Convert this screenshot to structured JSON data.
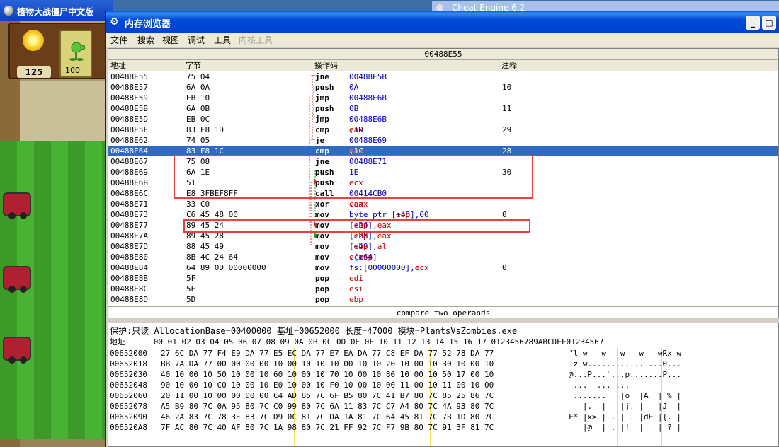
{
  "game": {
    "title": "植物大战僵尸中文版",
    "sun_count": "125",
    "seed_cost": "100",
    "colors": {
      "lawn_light": "#48b232",
      "lawn_dark": "#3c9a28"
    }
  },
  "background_window": {
    "title": "Cheat Engine 6.2"
  },
  "memory_viewer": {
    "title": "内存浏览器",
    "window_buttons": {
      "minimize": "_",
      "maximize": "□"
    },
    "menu": [
      "文件",
      "搜索",
      "视图",
      "调试",
      "工具",
      "内核工具"
    ],
    "disasm": {
      "current_address": "00488E55",
      "columns": [
        "地址",
        "字节",
        "操作码",
        "注释"
      ],
      "rows": [
        {
          "addr": "00488E55",
          "bytes": "75 04",
          "mnem": "jne",
          "ops": "00488E5B",
          "comment": ""
        },
        {
          "addr": "00488E57",
          "bytes": "6A 0A",
          "mnem": "push",
          "ops": "0A",
          "comment": "10"
        },
        {
          "addr": "00488E59",
          "bytes": "EB 10",
          "mnem": "jmp",
          "ops": "00488E6B",
          "comment": ""
        },
        {
          "addr": "00488E5B",
          "bytes": "6A 0B",
          "mnem": "push",
          "ops": "0B",
          "comment": "11"
        },
        {
          "addr": "00488E5D",
          "bytes": "EB 0C",
          "mnem": "jmp",
          "ops": "00488E6B",
          "comment": ""
        },
        {
          "addr": "00488E5F",
          "bytes": "83 F8 1D",
          "mnem": "cmp",
          "ops": "eax,1D",
          "comment": "29"
        },
        {
          "addr": "00488E62",
          "bytes": "74 05",
          "mnem": "je",
          "ops": "00488E69",
          "comment": ""
        },
        {
          "addr": "00488E64",
          "bytes": "83 F8 1C",
          "mnem": "cmp",
          "ops": "eax,1C",
          "comment": "28",
          "selected": true
        },
        {
          "addr": "00488E67",
          "bytes": "75 08",
          "mnem": "jne",
          "ops": "00488E71",
          "comment": ""
        },
        {
          "addr": "00488E69",
          "bytes": "6A 1E",
          "mnem": "push",
          "ops": "1E",
          "comment": "30"
        },
        {
          "addr": "00488E6B",
          "bytes": "51",
          "mnem": "push",
          "ops": "ecx",
          "comment": ""
        },
        {
          "addr": "00488E6C",
          "bytes": "E8 3FBEF8FF",
          "mnem": "call",
          "ops": "00414CB0",
          "comment": ""
        },
        {
          "addr": "00488E71",
          "bytes": "33 C0",
          "mnem": "xor",
          "ops": "eax,eax",
          "comment": ""
        },
        {
          "addr": "00488E73",
          "bytes": "C6 45 48 00",
          "mnem": "mov",
          "ops": "byte ptr [ebp+48],00",
          "comment": "0"
        },
        {
          "addr": "00488E77",
          "bytes": "89 45 24",
          "mnem": "mov",
          "ops": "[ebp+24],eax",
          "comment": ""
        },
        {
          "addr": "00488E7A",
          "bytes": "89 45 28",
          "mnem": "mov",
          "ops": "[ebp+28],eax",
          "comment": ""
        },
        {
          "addr": "00488E7D",
          "bytes": "88 45 49",
          "mnem": "mov",
          "ops": "[ebp+49],al",
          "comment": ""
        },
        {
          "addr": "00488E80",
          "bytes": "8B 4C 24 64",
          "mnem": "mov",
          "ops": "ecx,[esp+64]",
          "comment": ""
        },
        {
          "addr": "00488E84",
          "bytes": "64 89 0D 00000000",
          "mnem": "mov",
          "ops": "fs:[00000000],ecx",
          "comment": "0"
        },
        {
          "addr": "00488E8B",
          "bytes": "5F",
          "mnem": "pop",
          "ops": "edi",
          "comment": ""
        },
        {
          "addr": "00488E8C",
          "bytes": "5E",
          "mnem": "pop",
          "ops": "esi",
          "comment": ""
        },
        {
          "addr": "00488E8D",
          "bytes": "5D",
          "mnem": "pop",
          "ops": "ebp",
          "comment": ""
        }
      ],
      "description": "compare two operands"
    },
    "hex": {
      "info": "保护:只读  AllocationBase=00400000 基址=00652000 长度=47000 模块=PlantsVsZombies.exe",
      "header": "地址      00 01 02 03 04 05 06 07 08 09 0A 0B 0C 0D 0E 0F 10 11 12 13 14 15 16 17 0123456789ABCDEF01234567",
      "rows": [
        {
          "addr": "00652000",
          "bytes": "27 6C DA 77 F4 E9 DA 77 E5 EC DA 77 E7 EA DA 77 C8 EF DA 77 52 78 DA 77",
          "ascii": "'l w   w   w   w   wRx w"
        },
        {
          "addr": "00652018",
          "bytes": "BB 7A DA 77 00 00 00 00 10 00 10 10 10 00 10 10 20 10 00 10 30 10 00 10",
          "ascii": " z w............ ...0..."
        },
        {
          "addr": "00652030",
          "bytes": "40 10 00 10 50 10 00 10 60 10 00 10 70 10 00 10 80 10 00 10 50 17 00 10",
          "ascii": "@...P...`...p.......P..."
        },
        {
          "addr": "00652048",
          "bytes": "90 10 00 10 C0 10 00 10 E0 10 00 10 F0 10 00 10 00 11 00 10 11 00 10 00",
          "ascii": " ...  ... ..."
        },
        {
          "addr": "00652060",
          "bytes": "20 11 00 10 00 00 00 00 C4 AD 85 7C 6F B5 80 7C 41 B7 80 7C 85 25 86 7C",
          "ascii": " .......   |o  |A  | % |"
        },
        {
          "addr": "00652078",
          "bytes": "A5 B9 80 7C 0A 95 80 7C C0 99 80 7C 6A 11 83 7C C7 A4 80 7C 4A 93 80 7C",
          "ascii": "   |.  |   |j. |   |J  |"
        },
        {
          "addr": "00652090",
          "bytes": "46 2A 83 7C 78 3E 83 7C D9 0C 81 7C DA 1A 81 7C 64 45 81 7C 7B 1D 80 7C",
          "ascii": "F* |x> | . | . |dE |{. |"
        },
        {
          "addr": "006520A8",
          "bytes": "7F AC 80 7C 40 AF 80 7C 1A 98 80 7C 21 FF 92 7C F7 9B 80 7C 91 3F 81 7C",
          "ascii": "   |@  | . |!  |   | ? |"
        }
      ]
    }
  }
}
